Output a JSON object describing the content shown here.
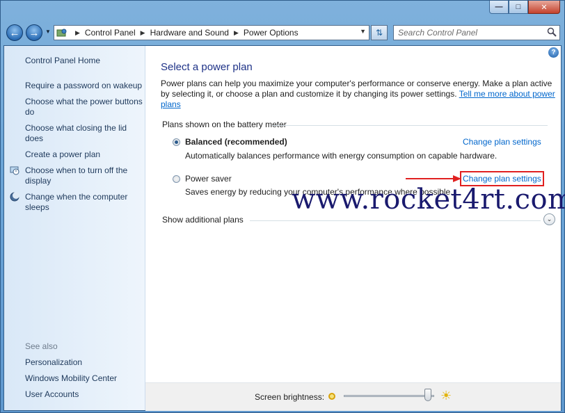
{
  "window": {
    "minimize_glyph": "—",
    "maximize_glyph": "□",
    "close_glyph": "✕"
  },
  "toolbar": {
    "breadcrumbs": [
      "Control Panel",
      "Hardware and Sound",
      "Power Options"
    ],
    "search_placeholder": "Search Control Panel"
  },
  "sidebar": {
    "home": "Control Panel Home",
    "items": [
      "Require a password on wakeup",
      "Choose what the power buttons do",
      "Choose what closing the lid does",
      "Create a power plan",
      "Choose when to turn off the display",
      "Change when the computer sleeps"
    ],
    "see_also_label": "See also",
    "see_also": [
      "Personalization",
      "Windows Mobility Center",
      "User Accounts"
    ]
  },
  "main": {
    "help_glyph": "?",
    "title": "Select a power plan",
    "intro_text": "Power plans can help you maximize your computer's performance or conserve energy. Make a plan active by selecting it, or choose a plan and customize it by changing its power settings.",
    "intro_link": "Tell me more about power plans",
    "group_label": "Plans shown on the battery meter",
    "plans": [
      {
        "name": "Balanced (recommended)",
        "selected": true,
        "description": "Automatically balances performance with energy consumption on capable hardware.",
        "link": "Change plan settings"
      },
      {
        "name": "Power saver",
        "selected": false,
        "description": "Saves energy by reducing your computer's performance where possible.",
        "link": "Change plan settings"
      }
    ],
    "show_additional": "Show additional plans",
    "expand_glyph": "⌄",
    "watermark": "www.rocket4rt.com"
  },
  "footer": {
    "brightness_label": "Screen brightness:",
    "brightness_level": 0.93
  },
  "colors": {
    "link": "#0066cc",
    "title": "#1e3287",
    "highlight": "#e02020",
    "sidebar_text": "#1e395b"
  }
}
